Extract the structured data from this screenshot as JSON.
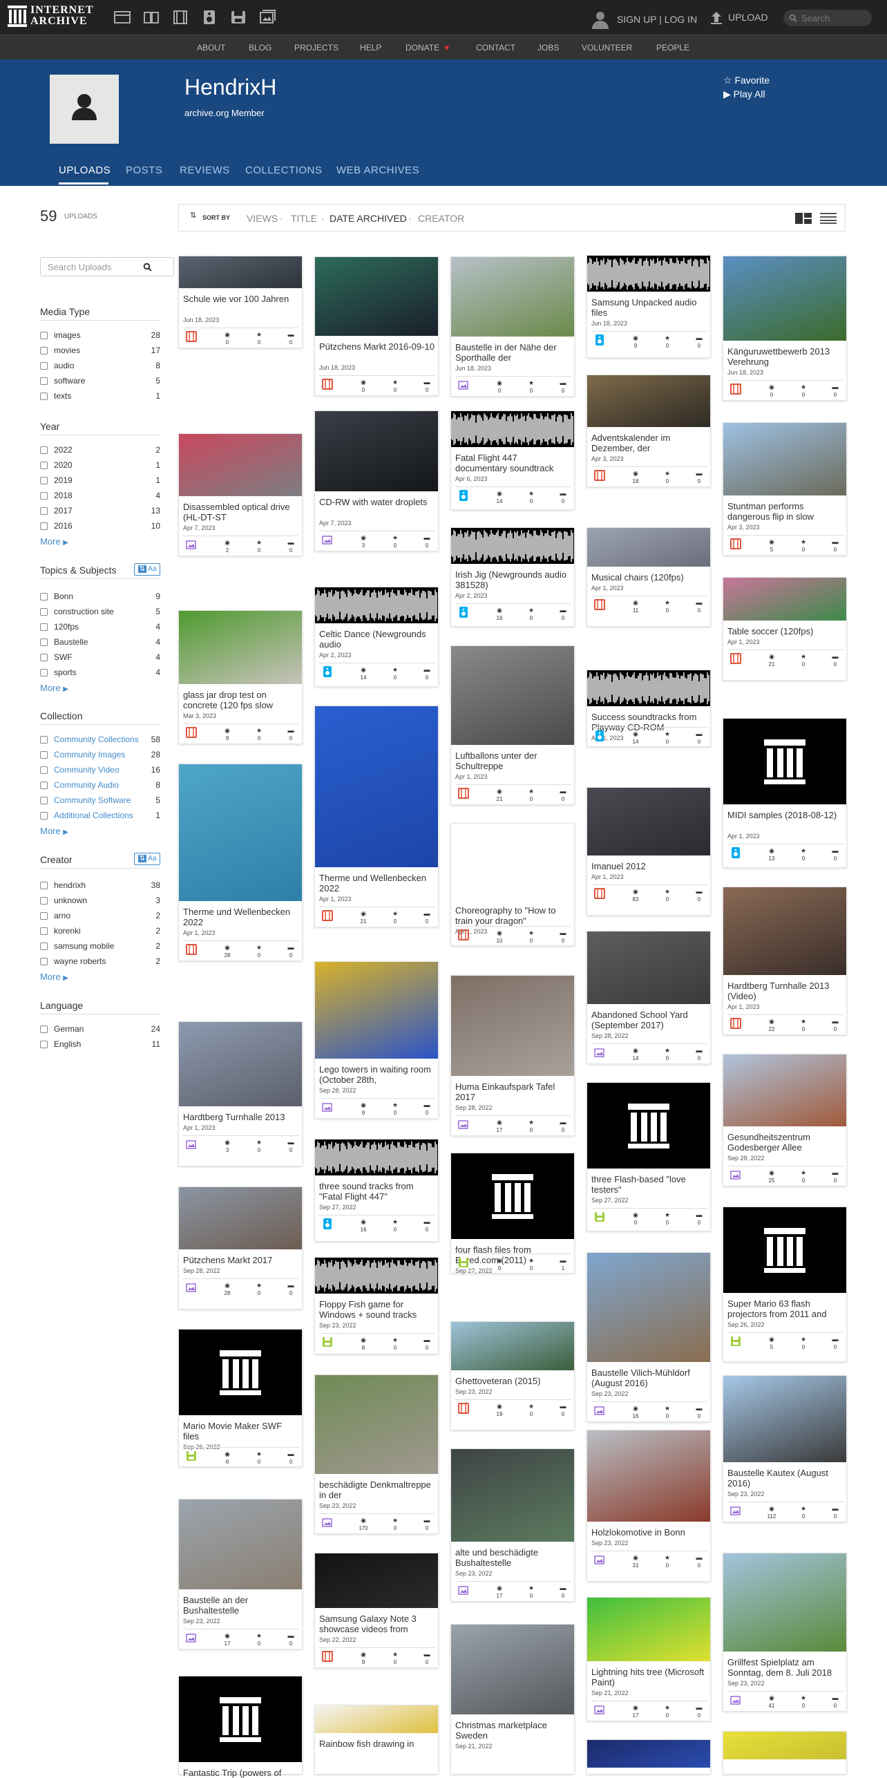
{
  "topnav": {
    "logo_line1": "INTERNET",
    "logo_line2": "ARCHIVE",
    "signup": "SIGN UP | LOG IN",
    "upload": "UPLOAD",
    "search_placeholder": "Search"
  },
  "subnav": [
    "ABOUT",
    "BLOG",
    "PROJECTS",
    "HELP",
    "DONATE",
    "CONTACT",
    "JOBS",
    "VOLUNTEER",
    "PEOPLE"
  ],
  "profile": {
    "name": "HendrixH",
    "member": "archive.org Member",
    "favorite": "Favorite",
    "play_all": "Play All"
  },
  "tabs": [
    "UPLOADS",
    "POSTS",
    "REVIEWS",
    "COLLECTIONS",
    "WEB ARCHIVES"
  ],
  "uploads": {
    "count": "59",
    "label": "UPLOADS"
  },
  "sort": {
    "label": "SORT BY",
    "options": [
      "VIEWS",
      "TITLE",
      "DATE ARCHIVED",
      "CREATOR"
    ]
  },
  "search_uploads_placeholder": "Search Uploads",
  "facets": {
    "media_type": {
      "title": "Media Type",
      "rows": [
        [
          "images",
          "28"
        ],
        [
          "movies",
          "17"
        ],
        [
          "audio",
          "8"
        ],
        [
          "software",
          "5"
        ],
        [
          "texts",
          "1"
        ]
      ]
    },
    "year": {
      "title": "Year",
      "rows": [
        [
          "2022",
          "2"
        ],
        [
          "2020",
          "1"
        ],
        [
          "2019",
          "1"
        ],
        [
          "2018",
          "4"
        ],
        [
          "2017",
          "13"
        ],
        [
          "2016",
          "10"
        ]
      ],
      "more": "More"
    },
    "topics": {
      "title": "Topics & Subjects",
      "rows": [
        [
          "Bonn",
          "9"
        ],
        [
          "construction site",
          "5"
        ],
        [
          "120fps",
          "4"
        ],
        [
          "Baustelle",
          "4"
        ],
        [
          "SWF",
          "4"
        ],
        [
          "sports",
          "4"
        ]
      ],
      "more": "More"
    },
    "collection": {
      "title": "Collection",
      "rows": [
        [
          "Community Collections",
          "58"
        ],
        [
          "Community Images",
          "28"
        ],
        [
          "Community Video",
          "16"
        ],
        [
          "Community Audio",
          "8"
        ],
        [
          "Community Software",
          "5"
        ],
        [
          "Additional Collections",
          "1"
        ]
      ],
      "more": "More"
    },
    "creator": {
      "title": "Creator",
      "rows": [
        [
          "hendrixh",
          "38"
        ],
        [
          "unknown",
          "3"
        ],
        [
          "arno",
          "2"
        ],
        [
          "korenki",
          "2"
        ],
        [
          "samsung mobile",
          "2"
        ],
        [
          "wayne roberts",
          "2"
        ]
      ],
      "more": "More"
    },
    "language": {
      "title": "Language",
      "rows": [
        [
          "German",
          "24"
        ],
        [
          "English",
          "11"
        ]
      ]
    },
    "az_label": "Aa"
  },
  "tiles": [
    [
      {
        "title": "Schule wie vor 100 Jahren",
        "date": "Jun 18, 2023",
        "type": "movies",
        "views": "0",
        "favs": "0",
        "reviews": "0",
        "img": "photo",
        "c1": "#5a6470",
        "c2": "#2e333a"
      },
      {
        "title": "Disassembled optical drive (HL-DT-ST",
        "date": "Apr 7, 2023",
        "type": "images",
        "views": "2",
        "favs": "0",
        "reviews": "0",
        "img": "photo",
        "c1": "#c9485e",
        "c2": "#7c7e82"
      },
      {
        "title": "glass jar drop test on concrete (120 fps slow",
        "date": "Mar 3, 2023",
        "type": "movies",
        "views": "9",
        "favs": "0",
        "reviews": "0",
        "img": "photo",
        "c1": "#4f9a2f",
        "c2": "#c8c3bb"
      },
      {
        "title": "Therme und Wellenbecken 2022",
        "date": "Apr 1, 2023",
        "type": "movies",
        "views": "28",
        "favs": "0",
        "reviews": "0",
        "img": "photo",
        "c1": "#4fa6c6",
        "c2": "#2f7fa8"
      },
      {
        "title": "Hardtberg Turnhalle 2013",
        "date": "Apr 1, 2023",
        "type": "images",
        "views": "3",
        "favs": "0",
        "reviews": "0",
        "img": "photo",
        "c1": "#8e9ab0",
        "c2": "#5b5f6a"
      },
      {
        "title": "Pützchens Markt 2017",
        "date": "Sep 28, 2022",
        "type": "images",
        "views": "28",
        "favs": "0",
        "reviews": "0",
        "img": "photo",
        "c1": "#8b95a3",
        "c2": "#6d5d52"
      },
      {
        "title": "Mario Movie Maker SWF files",
        "date": "Sep 26, 2022",
        "type": "software",
        "views": "6",
        "favs": "0",
        "reviews": "0",
        "img": "logo"
      },
      {
        "title": "Baustelle an der Bushaltestelle",
        "date": "Sep 23, 2022",
        "type": "images",
        "views": "17",
        "favs": "0",
        "reviews": "0",
        "img": "photo",
        "c1": "#9ba4ad",
        "c2": "#8a7f72"
      },
      {
        "title": "Fantastic Trip (powers of",
        "date": "",
        "type": "software",
        "views": "",
        "favs": "",
        "reviews": "",
        "img": "logo"
      }
    ],
    [
      {
        "title": "Pützchens Markt 2016-09-10",
        "date": "Jun 18, 2023",
        "type": "movies",
        "views": "0",
        "favs": "0",
        "reviews": "0",
        "img": "photo",
        "c1": "#2d6b5a",
        "c2": "#1a1f2a"
      },
      {
        "title": "CD-RW with water droplets",
        "date": "Apr 7, 2023",
        "type": "images",
        "views": "3",
        "favs": "0",
        "reviews": "0",
        "img": "photo",
        "c1": "#3a3f46",
        "c2": "#14161a"
      },
      {
        "title": "Celtic Dance (Newgrounds audio",
        "date": "Apr 2, 2023",
        "type": "audio",
        "views": "14",
        "favs": "0",
        "reviews": "0",
        "img": "wave"
      },
      {
        "title": "Therme und Wellenbecken 2022",
        "date": "Apr 1, 2023",
        "type": "movies",
        "views": "21",
        "favs": "0",
        "reviews": "0",
        "img": "photo",
        "c1": "#2a5fd0",
        "c2": "#1c45a8"
      },
      {
        "title": "Lego towers in waiting room (October 28th,",
        "date": "Sep 28, 2022",
        "type": "images",
        "views": "9",
        "favs": "0",
        "reviews": "0",
        "img": "photo",
        "c1": "#d8b22a",
        "c2": "#2b54c8"
      },
      {
        "title": "three sound tracks from \"Fatal Flight 447\"",
        "date": "Sep 27, 2022",
        "type": "audio",
        "views": "16",
        "favs": "0",
        "reviews": "0",
        "img": "wave"
      },
      {
        "title": "Floppy Fish game for Windows + sound tracks",
        "date": "Sep 23, 2022",
        "type": "software",
        "views": "8",
        "favs": "0",
        "reviews": "0",
        "img": "wave"
      },
      {
        "title": "beschädigte Denkmaltreppe in der",
        "date": "Sep 23, 2022",
        "type": "images",
        "views": "170",
        "favs": "0",
        "reviews": "0",
        "img": "photo",
        "c1": "#6f8b55",
        "c2": "#a09890"
      },
      {
        "title": "Samsung Galaxy Note 3 showcase videos from",
        "date": "Sep 22, 2022",
        "type": "movies",
        "views": "9",
        "favs": "0",
        "reviews": "0",
        "img": "photo",
        "c1": "#121314",
        "c2": "#2a2b2d"
      },
      {
        "title": "Rainbow fish drawing in",
        "date": "",
        "type": "images",
        "views": "",
        "favs": "",
        "reviews": "",
        "img": "photo",
        "c1": "#f4f4f4",
        "c2": "#e0c040"
      }
    ],
    [
      {
        "title": "Baustelle in der Nähe der Sporthalle der",
        "date": "Jun 18, 2023",
        "type": "images",
        "views": "0",
        "favs": "0",
        "reviews": "0",
        "img": "photo",
        "c1": "#b6c0c8",
        "c2": "#6b8a4a"
      },
      {
        "title": "Fatal Flight 447 documentary soundtrack",
        "date": "Apr 6, 2023",
        "type": "audio",
        "views": "14",
        "favs": "0",
        "reviews": "0",
        "img": "wave"
      },
      {
        "title": "Irish Jig (Newgrounds audio 381528)",
        "date": "Apr 2, 2023",
        "type": "audio",
        "views": "16",
        "favs": "0",
        "reviews": "0",
        "img": "wave"
      },
      {
        "title": "Luftballons unter der Schultreppe",
        "date": "Apr 1, 2023",
        "type": "movies",
        "views": "21",
        "favs": "0",
        "reviews": "0",
        "img": "photo",
        "c1": "#8a8a8a",
        "c2": "#4a4a4a"
      },
      {
        "title": "Choreography to \"How to train your dragon\"",
        "date": "Apr 1, 2023",
        "type": "movies",
        "views": "10",
        "favs": "0",
        "reviews": "0",
        "img": "blank"
      },
      {
        "title": "Huma Einkaufspark Tafel 2017",
        "date": "Sep 28, 2022",
        "type": "images",
        "views": "17",
        "favs": "0",
        "reviews": "0",
        "img": "photo",
        "c1": "#7d6f66",
        "c2": "#a8a19a"
      },
      {
        "title": "four flash files from Bored.com (2011)",
        "date": "Sep 27, 2022",
        "type": "software",
        "views": "0",
        "favs": "0",
        "reviews": "1",
        "img": "logo"
      },
      {
        "title": "Ghettoveteran (2015)",
        "date": "Sep 23, 2022",
        "type": "movies",
        "views": "19",
        "favs": "0",
        "reviews": "0",
        "img": "photo",
        "c1": "#9ec3d8",
        "c2": "#3b5e3a"
      },
      {
        "title": "alte und beschädigte Bushaltestelle",
        "date": "Sep 23, 2022",
        "type": "images",
        "views": "17",
        "favs": "0",
        "reviews": "0",
        "img": "photo",
        "c1": "#3e4446",
        "c2": "#5b7a5e"
      },
      {
        "title": "Christmas marketplace Sweden",
        "date": "Sep 21, 2022",
        "type": "images",
        "views": "",
        "favs": "",
        "reviews": "",
        "img": "photo",
        "c1": "#9aa3ab",
        "c2": "#55585c"
      }
    ],
    [
      {
        "title": "Samsung Unpacked audio files",
        "date": "Jun 18, 2023",
        "type": "audio",
        "views": "9",
        "favs": "0",
        "reviews": "0",
        "img": "wave"
      },
      {
        "title": "Adventskalender im Dezember, der",
        "date": "Apr 3, 2023",
        "type": "movies",
        "views": "18",
        "favs": "0",
        "reviews": "0",
        "img": "photo",
        "c1": "#7e6a4a",
        "c2": "#2e2a24"
      },
      {
        "title": "Musical chairs (120fps)",
        "date": "Apr 1, 2023",
        "type": "movies",
        "views": "11",
        "favs": "0",
        "reviews": "0",
        "img": "photo",
        "c1": "#9ca4b0",
        "c2": "#6b6e7a"
      },
      {
        "title": "Success soundtracks from Playway CD-ROM",
        "date": "Apr 1, 2023",
        "type": "audio",
        "views": "14",
        "favs": "0",
        "reviews": "0",
        "img": "wave"
      },
      {
        "title": "Imanuel 2012",
        "date": "Apr 1, 2023",
        "type": "movies",
        "views": "83",
        "favs": "0",
        "reviews": "0",
        "img": "photo",
        "c1": "#4a4a52",
        "c2": "#2a2a30"
      },
      {
        "title": "Abandoned School Yard (September 2017)",
        "date": "Sep 28, 2022",
        "type": "images",
        "views": "14",
        "favs": "0",
        "reviews": "0",
        "img": "photo",
        "c1": "#5d5d5b",
        "c2": "#3a3a38"
      },
      {
        "title": "three Flash-based \"love testers\"",
        "date": "Sep 27, 2022",
        "type": "software",
        "views": "0",
        "favs": "0",
        "reviews": "0",
        "img": "logo"
      },
      {
        "title": "Baustelle Vilich-Mühldorf (August 2016)",
        "date": "Sep 23, 2022",
        "type": "images",
        "views": "16",
        "favs": "0",
        "reviews": "0",
        "img": "photo",
        "c1": "#7fa6cf",
        "c2": "#8a6d4f"
      },
      {
        "title": "Holzlokomotive in Bonn",
        "date": "Sep 23, 2022",
        "type": "images",
        "views": "31",
        "favs": "0",
        "reviews": "0",
        "img": "photo",
        "c1": "#b9bfc5",
        "c2": "#8a3a2a"
      },
      {
        "title": "Lightning hits tree (Microsoft Paint)",
        "date": "Sep 21, 2022",
        "type": "images",
        "views": "17",
        "favs": "0",
        "reviews": "0",
        "img": "photo",
        "c1": "#3fbf3f",
        "c2": "#e0e030"
      },
      {
        "title": "",
        "date": "",
        "type": "images",
        "views": "",
        "favs": "",
        "reviews": "",
        "img": "photo",
        "c1": "#1c2a6a",
        "c2": "#2a4db0"
      }
    ],
    [
      {
        "title": "Känguruwettbewerb 2013 Verehrung",
        "date": "Jun 18, 2023",
        "type": "movies",
        "views": "0",
        "favs": "0",
        "reviews": "0",
        "img": "photo",
        "c1": "#5b8fc4",
        "c2": "#3b6a2a"
      },
      {
        "title": "Stuntman performs dangerous flip in slow",
        "date": "Apr 3, 2023",
        "type": "movies",
        "views": "5",
        "favs": "0",
        "reviews": "0",
        "img": "photo",
        "c1": "#9ec1e3",
        "c2": "#6b6a5a"
      },
      {
        "title": "Table soccer (120fps)",
        "date": "Apr 1, 2023",
        "type": "movies",
        "views": "21",
        "favs": "0",
        "reviews": "0",
        "img": "photo",
        "c1": "#c8769a",
        "c2": "#3d8a4a"
      },
      {
        "title": "MIDI samples (2018-08-12)",
        "date": "Apr 1, 2023",
        "type": "audio",
        "views": "13",
        "favs": "0",
        "reviews": "0",
        "img": "logo"
      },
      {
        "title": "Hardtberg Turnhalle 2013 (Video)",
        "date": "Apr 1, 2023",
        "type": "movies",
        "views": "22",
        "favs": "0",
        "reviews": "0",
        "img": "photo",
        "c1": "#8a6a55",
        "c2": "#3a2e2a"
      },
      {
        "title": "Gesundheitszentrum Godesberger Allee",
        "date": "Sep 28, 2022",
        "type": "images",
        "views": "25",
        "favs": "0",
        "reviews": "0",
        "img": "photo",
        "c1": "#b0c4dc",
        "c2": "#a05a3a"
      },
      {
        "title": "Super Mario 63 flash projectors from 2011 and",
        "date": "Sep 26, 2022",
        "type": "software",
        "views": "5",
        "favs": "0",
        "reviews": "0",
        "img": "logo"
      },
      {
        "title": "Baustelle Kautex (August 2016)",
        "date": "Sep 23, 2022",
        "type": "images",
        "views": "112",
        "favs": "0",
        "reviews": "0",
        "img": "photo",
        "c1": "#a6c8e8",
        "c2": "#3a3a3a"
      },
      {
        "title": "Grillfest Spielplatz am Sonntag, dem 8. Juli 2018",
        "date": "Sep 23, 2022",
        "type": "images",
        "views": "41",
        "favs": "0",
        "reviews": "0",
        "img": "photo",
        "c1": "#a3c3dd",
        "c2": "#5a8a3a"
      },
      {
        "title": "",
        "date": "",
        "type": "images",
        "views": "",
        "favs": "",
        "reviews": "",
        "img": "photo",
        "c1": "#e8e03a",
        "c2": "#c8c030"
      }
    ]
  ],
  "colors": {
    "banner": "#194880",
    "topnav": "#222222",
    "subnav": "#333333",
    "movies": "#e0533b",
    "images": "#9a6cd8",
    "audio": "#00adef",
    "software": "#9ecc3b",
    "link": "#428bca"
  }
}
